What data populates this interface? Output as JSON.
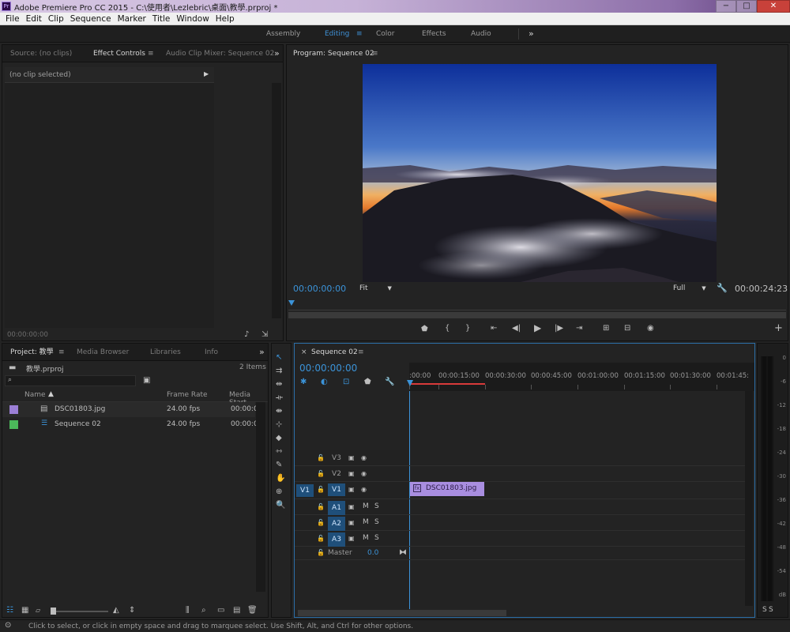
{
  "window": {
    "title": "Adobe Premiere Pro CC 2015 - C:\\使用者\\Lezlebric\\桌面\\教學.prproj *",
    "app_icon": "Pr",
    "min": "−",
    "max": "□",
    "close": "✕"
  },
  "menu": [
    "File",
    "Edit",
    "Clip",
    "Sequence",
    "Marker",
    "Title",
    "Window",
    "Help"
  ],
  "workspaces": {
    "items": [
      "Assembly",
      "Editing",
      "Color",
      "Effects",
      "Audio"
    ],
    "active": "Editing",
    "more": "»"
  },
  "source_panel": {
    "tabs": [
      "Source: (no clips)",
      "Effect Controls",
      "Audio Clip Mixer: Sequence 02"
    ],
    "active_tab": "Effect Controls",
    "no_clip": "(no clip selected)",
    "timecode": "00:00:00:00"
  },
  "program_panel": {
    "title": "Program: Sequence 02",
    "timecode": "00:00:00:00",
    "fit": "Fit",
    "quality": "Full",
    "duration": "00:00:24:23",
    "video_alt": "Sunrise over cloud-covered mountains",
    "controls": [
      "marker-icon",
      "in-point-icon",
      "out-point-icon",
      "go-to-in-icon",
      "step-back-icon",
      "play-icon",
      "step-forward-icon",
      "go-to-out-icon",
      "lift-icon",
      "extract-icon",
      "export-frame-icon",
      "add-button-icon"
    ]
  },
  "project_panel": {
    "tabs": [
      "Project: 教學",
      "Media Browser",
      "Libraries",
      "Info"
    ],
    "active_tab": "Project: 教學",
    "file": "教學.prproj",
    "count": "2 Items",
    "columns": [
      "Name",
      "Frame Rate",
      "Media Start"
    ],
    "items": [
      {
        "name": "DSC01803.jpg",
        "rate": "24.00 fps",
        "start": "00:00:0",
        "color": "#9b7fd6",
        "type": "image"
      },
      {
        "name": "Sequence 02",
        "rate": "24.00 fps",
        "start": "00:00:0",
        "color": "#4bb85a",
        "type": "sequence"
      }
    ]
  },
  "timeline": {
    "tab": "Sequence 02",
    "timecode": "00:00:00:00",
    "ruler": [
      ":00:00",
      "00:00:15:00",
      "00:00:30:00",
      "00:00:45:00",
      "00:01:00:00",
      "00:01:15:00",
      "00:01:30:00",
      "00:01:45:"
    ],
    "video_tracks": [
      "V3",
      "V2",
      "V1"
    ],
    "audio_tracks": [
      "A1",
      "A2",
      "A3"
    ],
    "source_patch": "V1",
    "master_label": "Master",
    "master_value": "0.0",
    "mute": "M",
    "solo": "S",
    "clip_name": "DSC01803.jpg",
    "clip_color": "#a98ee0"
  },
  "audio_meter": {
    "scale": [
      "0",
      "-6",
      "-12",
      "-18",
      "-24",
      "-30",
      "-36",
      "-42",
      "-48",
      "-54",
      "dB"
    ],
    "solo_labels": [
      "S",
      "S"
    ]
  },
  "statusbar": {
    "text": "Click to select, or click in empty space and drag to marquee select. Use Shift, Alt, and Ctrl for other options."
  },
  "colors": {
    "accent_blue": "#3b93d8",
    "playhead_red": "#d83a3a",
    "image_label": "#9b7fd6",
    "sequence_label": "#4bb85a"
  }
}
